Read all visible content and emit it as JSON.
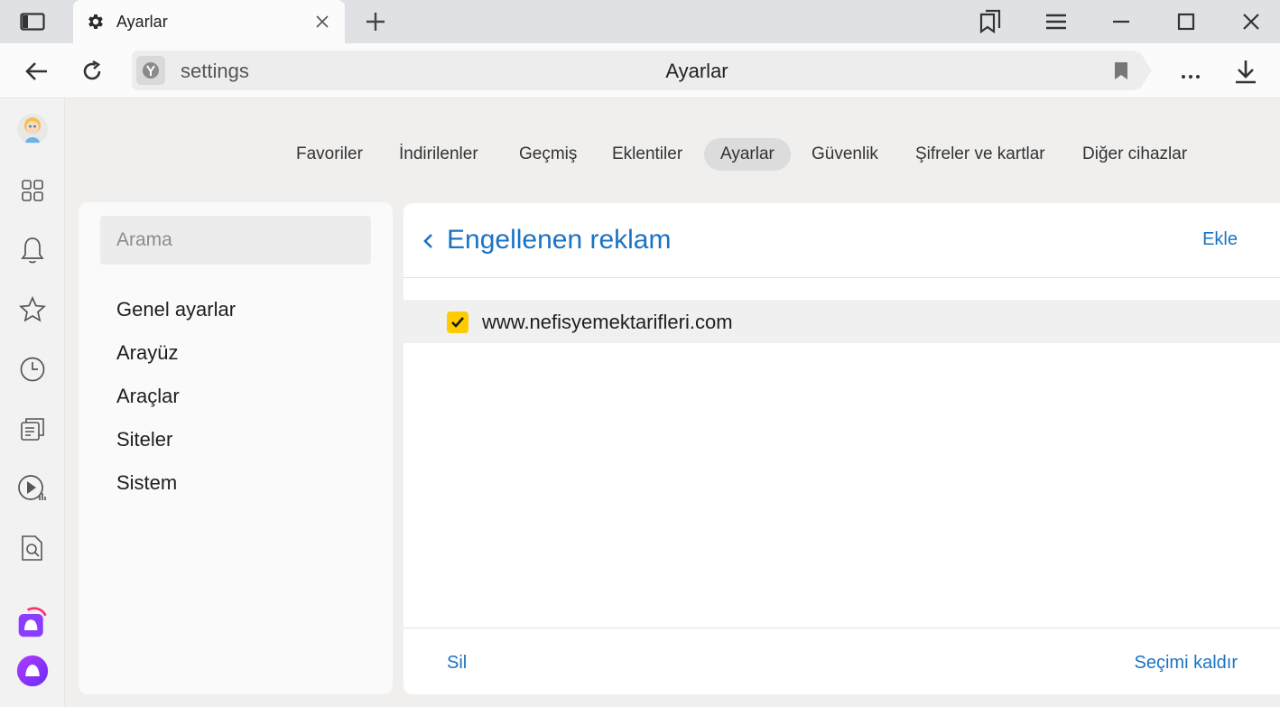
{
  "tab": {
    "title": "Ayarlar"
  },
  "address": {
    "url": "settings",
    "page_title": "Ayarlar"
  },
  "nav": {
    "items": [
      {
        "label": "Favoriler"
      },
      {
        "label": "İndirilenler"
      },
      {
        "label": "Geçmiş"
      },
      {
        "label": "Eklentiler"
      },
      {
        "label": "Ayarlar",
        "active": true
      },
      {
        "label": "Güvenlik"
      },
      {
        "label": "Şifreler ve kartlar"
      },
      {
        "label": "Diğer cihazlar"
      }
    ]
  },
  "sidebar": {
    "search_placeholder": "Arama",
    "items": [
      {
        "label": "Genel ayarlar"
      },
      {
        "label": "Arayüz"
      },
      {
        "label": "Araçlar"
      },
      {
        "label": "Siteler"
      },
      {
        "label": "Sistem"
      }
    ]
  },
  "panel": {
    "title": "Engellenen reklam",
    "add_label": "Ekle",
    "entries": [
      {
        "domain": "www.nefisyemektarifleri.com",
        "checked": true
      }
    ],
    "delete_label": "Sil",
    "deselect_label": "Seçimi kaldır"
  },
  "colors": {
    "accent": "#1a73c4",
    "checkbox": "#ffcc00"
  },
  "icons": {
    "left_bar": [
      "avatar",
      "apps-grid-icon",
      "bell-icon",
      "star-icon",
      "clock-icon",
      "news-icon",
      "video-icon",
      "search-document-icon",
      "messenger-icon",
      "alice-icon"
    ]
  }
}
